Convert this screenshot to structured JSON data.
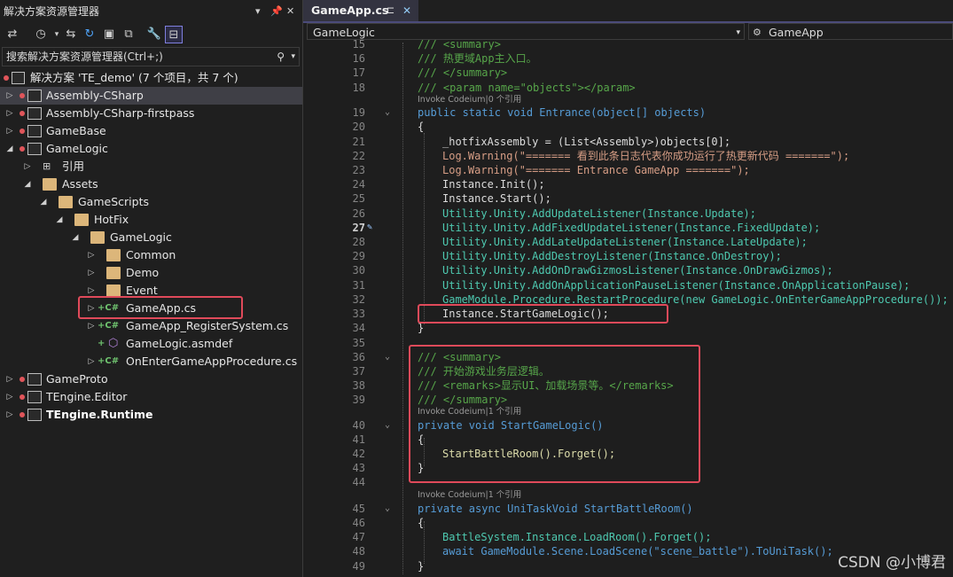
{
  "solution_explorer": {
    "title": "解决方案资源管理器",
    "search_placeholder": "搜索解决方案资源管理器(Ctrl+;)",
    "solution_label": "解决方案 'TE_demo' (7 个项目，共 7 个)",
    "items": [
      {
        "label": "Assembly-CSharp"
      },
      {
        "label": "Assembly-CSharp-firstpass"
      },
      {
        "label": "GameBase"
      },
      {
        "label": "GameLogic"
      },
      {
        "label": "引用"
      },
      {
        "label": "Assets"
      },
      {
        "label": "GameScripts"
      },
      {
        "label": "HotFix"
      },
      {
        "label": "GameLogic"
      },
      {
        "label": "Common"
      },
      {
        "label": "Demo"
      },
      {
        "label": "Event"
      },
      {
        "label": "GameApp.cs"
      },
      {
        "label": "GameApp_RegisterSystem.cs"
      },
      {
        "label": "GameLogic.asmdef"
      },
      {
        "label": "OnEnterGameAppProcedure.cs"
      },
      {
        "label": "GameProto"
      },
      {
        "label": "TEngine.Editor"
      },
      {
        "label": "TEngine.Runtime"
      }
    ]
  },
  "editor": {
    "tab_label": "GameApp.cs",
    "nav_left": "GameLogic",
    "nav_right": "GameApp",
    "lens_0": "Invoke Codeium|0 个引用",
    "lens_1": "Invoke Codeium|1 个引用",
    "lines": {
      "l15": "/// <summary>",
      "l16": "/// 热更域App主入口。",
      "l17": "/// </summary>",
      "l18": "/// <param name=\"objects\"></param>",
      "l19": "public static void Entrance(object[] objects)",
      "l20": "{",
      "l21": "_hotfixAssembly = (List<Assembly>)objects[0];",
      "l22": "Log.Warning(\"======= 看到此条日志代表你成功运行了热更新代码 =======\");",
      "l23": "Log.Warning(\"======= Entrance GameApp =======\");",
      "l24": "Instance.Init();",
      "l25": "Instance.Start();",
      "l26": "Utility.Unity.AddUpdateListener(Instance.Update);",
      "l27": "Utility.Unity.AddFixedUpdateListener(Instance.FixedUpdate);",
      "l28": "Utility.Unity.AddLateUpdateListener(Instance.LateUpdate);",
      "l29": "Utility.Unity.AddDestroyListener(Instance.OnDestroy);",
      "l30": "Utility.Unity.AddOnDrawGizmosListener(Instance.OnDrawGizmos);",
      "l31": "Utility.Unity.AddOnApplicationPauseListener(Instance.OnApplicationPause);",
      "l32": "GameModule.Procedure.RestartProcedure(new GameLogic.OnEnterGameAppProcedure());",
      "l33": "Instance.StartGameLogic();",
      "l34": "}",
      "l36": "/// <summary>",
      "l37": "/// 开始游戏业务层逻辑。",
      "l38": "/// <remarks>显示UI、加载场景等。</remarks>",
      "l39": "/// </summary>",
      "l40": "private void StartGameLogic()",
      "l41": "{",
      "l42": "StartBattleRoom().Forget();",
      "l43": "}",
      "l45": "private async UniTaskVoid StartBattleRoom()",
      "l46": "{",
      "l47": "BattleSystem.Instance.LoadRoom().Forget();",
      "l48": "await GameModule.Scene.LoadScene(\"scene_battle\").ToUniTask();",
      "l49": "}"
    }
  },
  "watermark": "CSDN @小博君",
  "colors": {
    "highlight_box": "#e04a5a",
    "comment": "#57a64a",
    "keyword": "#569cd6",
    "type": "#4ec9b0",
    "method": "#dcdcaa",
    "string": "#d69d85"
  }
}
